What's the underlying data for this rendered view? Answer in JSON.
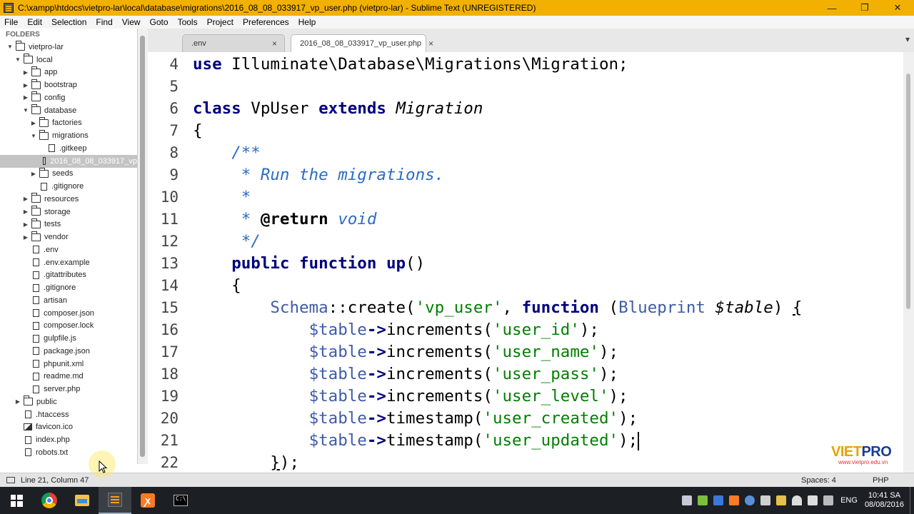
{
  "window": {
    "title": "C:\\xampp\\htdocs\\vietpro-lar\\local\\database\\migrations\\2016_08_08_033917_vp_user.php (vietpro-lar) - Sublime Text (UNREGISTERED)",
    "minimize": "—",
    "maximize": "❐",
    "close": "✕"
  },
  "menu": [
    "File",
    "Edit",
    "Selection",
    "Find",
    "View",
    "Goto",
    "Tools",
    "Project",
    "Preferences",
    "Help"
  ],
  "sidebar": {
    "header": "FOLDERS",
    "items": [
      {
        "label": "vietpro-lar",
        "type": "folder",
        "depth": 0,
        "expanded": true
      },
      {
        "label": "local",
        "type": "folder",
        "depth": 1,
        "expanded": true
      },
      {
        "label": "app",
        "type": "folder",
        "depth": 2,
        "expanded": false
      },
      {
        "label": "bootstrap",
        "type": "folder",
        "depth": 2,
        "expanded": false
      },
      {
        "label": "config",
        "type": "folder",
        "depth": 2,
        "expanded": false
      },
      {
        "label": "database",
        "type": "folder",
        "depth": 2,
        "expanded": true
      },
      {
        "label": "factories",
        "type": "folder",
        "depth": 3,
        "expanded": false
      },
      {
        "label": "migrations",
        "type": "folder",
        "depth": 3,
        "expanded": true
      },
      {
        "label": ".gitkeep",
        "type": "file",
        "depth": 4
      },
      {
        "label": "2016_08_08_033917_vp",
        "type": "file",
        "depth": 4,
        "selected": true
      },
      {
        "label": "seeds",
        "type": "folder",
        "depth": 3,
        "expanded": false
      },
      {
        "label": ".gitignore",
        "type": "file",
        "depth": 3
      },
      {
        "label": "resources",
        "type": "folder",
        "depth": 2,
        "expanded": false
      },
      {
        "label": "storage",
        "type": "folder",
        "depth": 2,
        "expanded": false
      },
      {
        "label": "tests",
        "type": "folder",
        "depth": 2,
        "expanded": false
      },
      {
        "label": "vendor",
        "type": "folder",
        "depth": 2,
        "expanded": false
      },
      {
        "label": ".env",
        "type": "file",
        "depth": 2
      },
      {
        "label": ".env.example",
        "type": "file",
        "depth": 2
      },
      {
        "label": ".gitattributes",
        "type": "file",
        "depth": 2
      },
      {
        "label": ".gitignore",
        "type": "file",
        "depth": 2
      },
      {
        "label": "artisan",
        "type": "file",
        "depth": 2
      },
      {
        "label": "composer.json",
        "type": "file",
        "depth": 2
      },
      {
        "label": "composer.lock",
        "type": "file",
        "depth": 2
      },
      {
        "label": "gulpfile.js",
        "type": "file",
        "depth": 2
      },
      {
        "label": "package.json",
        "type": "file",
        "depth": 2
      },
      {
        "label": "phpunit.xml",
        "type": "file",
        "depth": 2
      },
      {
        "label": "readme.md",
        "type": "file",
        "depth": 2
      },
      {
        "label": "server.php",
        "type": "file",
        "depth": 2
      },
      {
        "label": "public",
        "type": "folder",
        "depth": 1,
        "expanded": false
      },
      {
        "label": ".htaccess",
        "type": "file",
        "depth": 1
      },
      {
        "label": "favicon.ico",
        "type": "image",
        "depth": 1
      },
      {
        "label": "index.php",
        "type": "file",
        "depth": 1
      },
      {
        "label": "robots.txt",
        "type": "file",
        "depth": 1
      }
    ]
  },
  "tabs": [
    {
      "label": ".env",
      "close": "×",
      "active": false
    },
    {
      "label": "2016_08_08_033917_vp_user.php",
      "close": "×",
      "active": true
    }
  ],
  "tab_overflow": "▾",
  "editor": {
    "lines": [
      {
        "n": "4",
        "html": "<span class=\"kw\">use</span> Illuminate\\Database\\Migrations\\Migration;"
      },
      {
        "n": "5",
        "html": ""
      },
      {
        "n": "6",
        "html": "<span class=\"kw\">class</span> VpUser <span class=\"kw\">extends</span> <span class=\"it\">Migration</span>"
      },
      {
        "n": "7",
        "html": "{"
      },
      {
        "n": "8",
        "html": "    <span class=\"cm\">/**</span>"
      },
      {
        "n": "9",
        "html": "     <span class=\"cm\">* Run the migrations.</span>"
      },
      {
        "n": "10",
        "html": "     <span class=\"cm\">*</span>"
      },
      {
        "n": "11",
        "html": "     <span class=\"cm\">* <span class=\"ca\">@return</span> void</span>"
      },
      {
        "n": "12",
        "html": "     <span class=\"cm\">*/</span>"
      },
      {
        "n": "13",
        "html": "    <span class=\"kw\">public</span> <span class=\"kw\">function</span> <span class=\"op\">up</span>()"
      },
      {
        "n": "14",
        "html": "    {"
      },
      {
        "n": "15",
        "html": "        <span class=\"ty\">Schema</span>::create(<span class=\"st\">'vp_user'</span>, <span class=\"kw\">function</span> (<span class=\"ty\">Blueprint</span> <span class=\"it\">$table</span>) <u>{</u>"
      },
      {
        "n": "16",
        "html": "            <span class=\"var\">$table</span><span class=\"op\">-&gt;</span>increments(<span class=\"st\">'user_id'</span>);"
      },
      {
        "n": "17",
        "html": "            <span class=\"var\">$table</span><span class=\"op\">-&gt;</span>increments(<span class=\"st\">'user_name'</span>);"
      },
      {
        "n": "18",
        "html": "            <span class=\"var\">$table</span><span class=\"op\">-&gt;</span>increments(<span class=\"st\">'user_pass'</span>);"
      },
      {
        "n": "19",
        "html": "            <span class=\"var\">$table</span><span class=\"op\">-&gt;</span>increments(<span class=\"st\">'user_level'</span>);"
      },
      {
        "n": "20",
        "html": "            <span class=\"var\">$table</span><span class=\"op\">-&gt;</span>timestamp(<span class=\"st\">'user_created'</span>);"
      },
      {
        "n": "21",
        "html": "            <span class=\"var\">$table</span><span class=\"op\">-&gt;</span>timestamp(<span class=\"st\">'user_updated'</span>);<span class=\"caret\"></span>"
      },
      {
        "n": "22",
        "html": "        <u>}</u>);"
      }
    ]
  },
  "logo": {
    "brand_vi": "VIET",
    "brand_pro": "PRO",
    "site": "www.vietpro.edu.vn"
  },
  "status": {
    "position": "Line 21, Column 47",
    "indent": "Spaces: 4",
    "syntax": "PHP"
  },
  "taskbar": {
    "language": "ENG",
    "time": "10:41 SA",
    "date": "08/08/2016"
  },
  "colors": {
    "titlebar": "#f2b100",
    "keyword": "#00007f",
    "string": "#007f00",
    "comment": "#2b6bc6",
    "type": "#3e5ba9"
  }
}
